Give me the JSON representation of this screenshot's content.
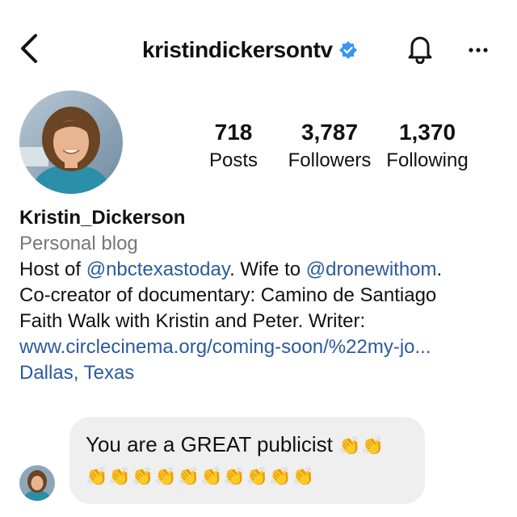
{
  "header": {
    "username": "kristindickersontv",
    "back_icon": "chevron-left-icon",
    "verified_icon": "verified-badge-icon",
    "bell_icon": "bell-icon",
    "more_icon": "more-horizontal-icon",
    "verified_color": "#3897f0"
  },
  "stats": {
    "posts": {
      "value": "718",
      "label": "Posts"
    },
    "followers": {
      "value": "3,787",
      "label": "Followers"
    },
    "following": {
      "value": "1,370",
      "label": "Following"
    }
  },
  "bio": {
    "name": "Kristin_Dickerson",
    "category": "Personal blog",
    "line1_prefix": "Host of ",
    "mention1": "@nbctexastoday",
    "line1_mid": ". Wife to ",
    "mention2": "@dronewithom",
    "line1_suffix": ".",
    "line2": "Co-creator of documentary: Camino de Santiago",
    "line3": "Faith Walk with Kristin and Peter. Writer:",
    "website": "www.circlecinema.org/coming-soon/%22my-jo...",
    "location": "Dallas, Texas",
    "link_color": "#2b5a9e"
  },
  "message": {
    "text": "You are a GREAT publicist",
    "claps_inline": "👏👏",
    "claps_row": "👏👏👏👏👏👏👏👏👏👏"
  }
}
